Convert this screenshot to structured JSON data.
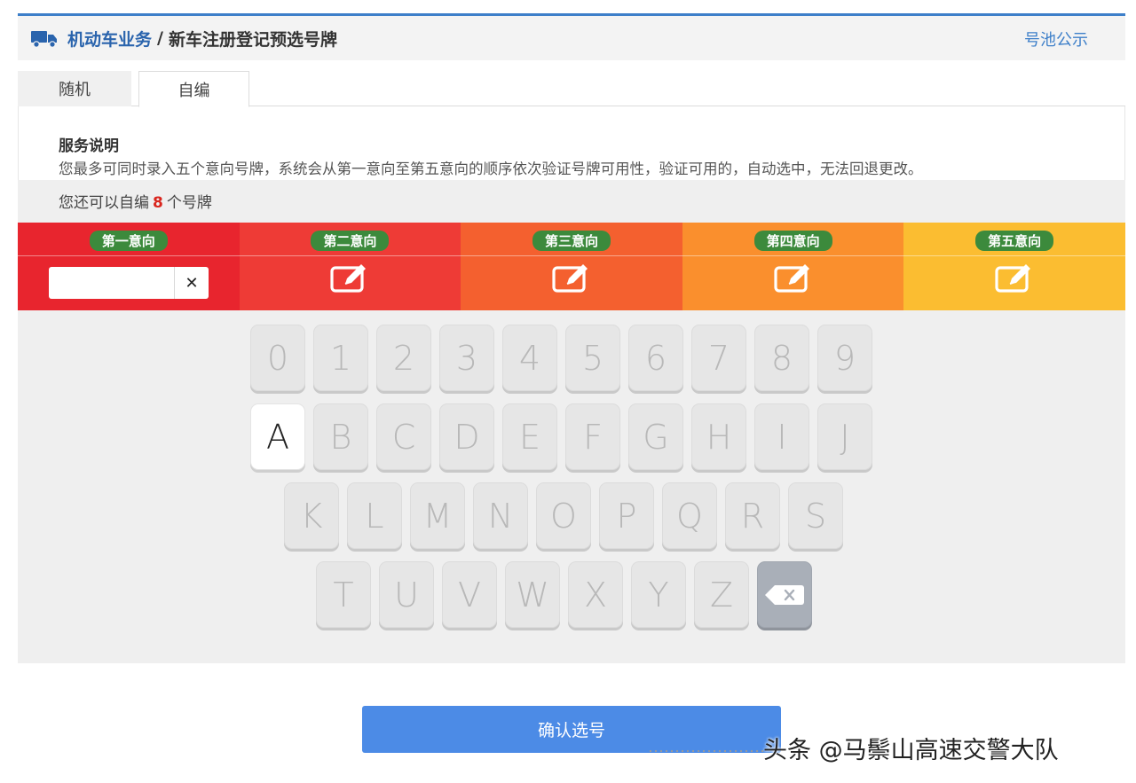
{
  "header": {
    "title_main": "机动车业务",
    "separator": "/",
    "title_sub": "新车注册登记预选号牌",
    "pool_link": "号池公示"
  },
  "tabs": [
    {
      "label": "随机",
      "active": false
    },
    {
      "label": "自编",
      "active": true
    }
  ],
  "service": {
    "title": "服务说明",
    "description": "您最多可同时录入五个意向号牌，系统会从第一意向至第五意向的顺序依次验证号牌可用性，验证可用的，自动选中，无法回退更改。"
  },
  "remaining": {
    "prefix": "您还可以自编",
    "count": "8",
    "suffix": "个号牌"
  },
  "choices": [
    {
      "label": "第一意向",
      "color": "#e8252e",
      "mode": "input",
      "value": "",
      "clear_icon": "✕"
    },
    {
      "label": "第二意向",
      "color": "#ee3b36",
      "mode": "edit-icon"
    },
    {
      "label": "第三意向",
      "color": "#f4602f",
      "mode": "edit-icon"
    },
    {
      "label": "第四意向",
      "color": "#fa8f2d",
      "mode": "edit-icon"
    },
    {
      "label": "第五意向",
      "color": "#fbbd31",
      "mode": "edit-icon"
    }
  ],
  "keyboard": {
    "rows": [
      [
        "0",
        "1",
        "2",
        "3",
        "4",
        "5",
        "6",
        "7",
        "8",
        "9"
      ],
      [
        "A",
        "B",
        "C",
        "D",
        "E",
        "F",
        "G",
        "H",
        "I",
        "J"
      ],
      [
        "K",
        "L",
        "M",
        "N",
        "O",
        "P",
        "Q",
        "R",
        "S"
      ],
      [
        "T",
        "U",
        "V",
        "W",
        "X",
        "Y",
        "Z"
      ]
    ],
    "active_key": "A",
    "backspace_icon": "backspace-icon"
  },
  "confirm_button": "确认选号",
  "watermark": "头条 @马鬃山高速交警大队"
}
